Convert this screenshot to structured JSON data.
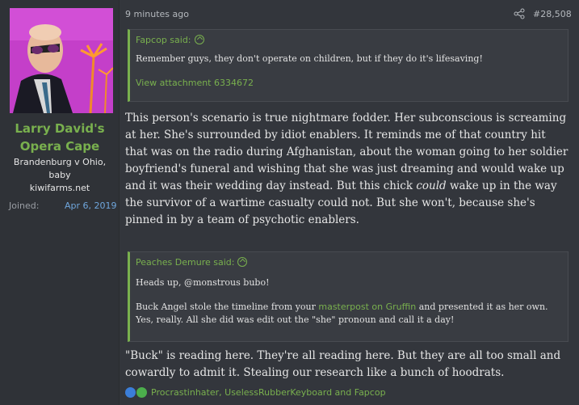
{
  "user": {
    "name_line1": "Larry David's",
    "name_line2": "Opera Cape",
    "title_line1": "Brandenburg v Ohio,",
    "title_line2": "baby",
    "site": "kiwifarms.net",
    "joined_label": "Joined:",
    "joined_value": "Apr 6, 2019"
  },
  "post": {
    "time": "9 minutes ago",
    "number": "#28,508",
    "quote1": {
      "author": "Fapcop said:",
      "text": "Remember guys, they don't operate on children, but if they do it's lifesaving!",
      "attachment": "View attachment 6334672"
    },
    "body1_a": "This person's scenario is true nightmare fodder. Her subconscious is screaming at her. She's surrounded by idiot enablers. It reminds me of that country hit that was on the radio during Afghanistan, about the woman going to her soldier boyfriend's funeral and wishing that she was just dreaming and would wake up and it was their wedding day instead. But this chick ",
    "body1_em": "could",
    "body1_b": " wake up in the way the survivor of a wartime casualty could not. But she won't, because she's pinned in by a team of psychotic enablers.",
    "quote2": {
      "author": "Peaches Demure said:",
      "line1": "Heads up, @monstrous bubo!",
      "line2_a": "Buck Angel stole the timeline from your ",
      "line2_link": "masterpost on Gruffin",
      "line2_b": " and presented it as her own. Yes, really. All she did was edit out the \"she\" pronoun and call it a day!"
    },
    "body2": "\"Buck\" is reading here. They're all reading here. But they are all too small and cowardly to admit it. Stealing our research like a bunch of hoodrats.",
    "reactions": "Procrastinhater, UselessRubberKeyboard and Fapcop"
  }
}
